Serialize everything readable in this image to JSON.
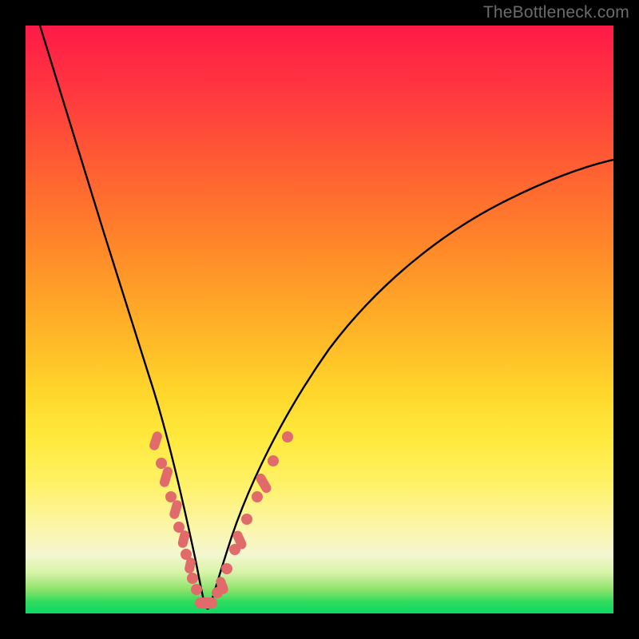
{
  "watermark": "TheBottleneck.com",
  "colors": {
    "gradient_top": "#ff1a47",
    "gradient_mid": "#ffd52a",
    "gradient_bottom": "#0ed863",
    "curve": "#000000",
    "marker": "#e16b6b",
    "frame": "#000000"
  },
  "chart_data": {
    "type": "line",
    "title": "",
    "xlabel": "",
    "ylabel": "",
    "xlim": [
      0,
      100
    ],
    "ylim": [
      0,
      100
    ],
    "grid": false,
    "legend": null,
    "series": [
      {
        "name": "bottleneck-curve",
        "x": [
          2,
          5,
          8,
          11,
          14,
          17,
          20,
          22,
          24,
          26,
          28,
          29,
          30,
          31,
          33,
          35,
          38,
          42,
          48,
          55,
          64,
          74,
          85,
          100
        ],
        "y": [
          100,
          88,
          77,
          66,
          55,
          45,
          36,
          29,
          22,
          15,
          9,
          5,
          2,
          2,
          5,
          10,
          18,
          27,
          38,
          47,
          55,
          62,
          67,
          73
        ]
      }
    ],
    "markers": {
      "name": "highlighted-points",
      "points": [
        {
          "x": 22.0,
          "y": 30.0
        },
        {
          "x": 23.0,
          "y": 26.0
        },
        {
          "x": 24.0,
          "y": 22.5
        },
        {
          "x": 25.0,
          "y": 19.0
        },
        {
          "x": 26.0,
          "y": 15.0
        },
        {
          "x": 27.0,
          "y": 11.5
        },
        {
          "x": 28.0,
          "y": 8.0
        },
        {
          "x": 28.5,
          "y": 6.0
        },
        {
          "x": 29.0,
          "y": 4.0
        },
        {
          "x": 29.5,
          "y": 2.5
        },
        {
          "x": 30.0,
          "y": 1.5
        },
        {
          "x": 30.5,
          "y": 1.2
        },
        {
          "x": 31.0,
          "y": 1.5
        },
        {
          "x": 31.5,
          "y": 2.5
        },
        {
          "x": 32.0,
          "y": 4.0
        },
        {
          "x": 33.0,
          "y": 6.5
        },
        {
          "x": 34.0,
          "y": 9.0
        },
        {
          "x": 35.0,
          "y": 12.0
        },
        {
          "x": 36.5,
          "y": 16.0
        },
        {
          "x": 38.0,
          "y": 20.0
        },
        {
          "x": 40.0,
          "y": 24.5
        },
        {
          "x": 42.0,
          "y": 28.5
        },
        {
          "x": 44.0,
          "y": 32.0
        }
      ]
    },
    "notes": "V-shaped bottleneck curve overlaid on a rainbow heat gradient. Minimum (0% bottleneck) occurs near x≈30. Pink markers highlight sampled points on both flanks of the minimum roughly between y=1 and y=32."
  }
}
